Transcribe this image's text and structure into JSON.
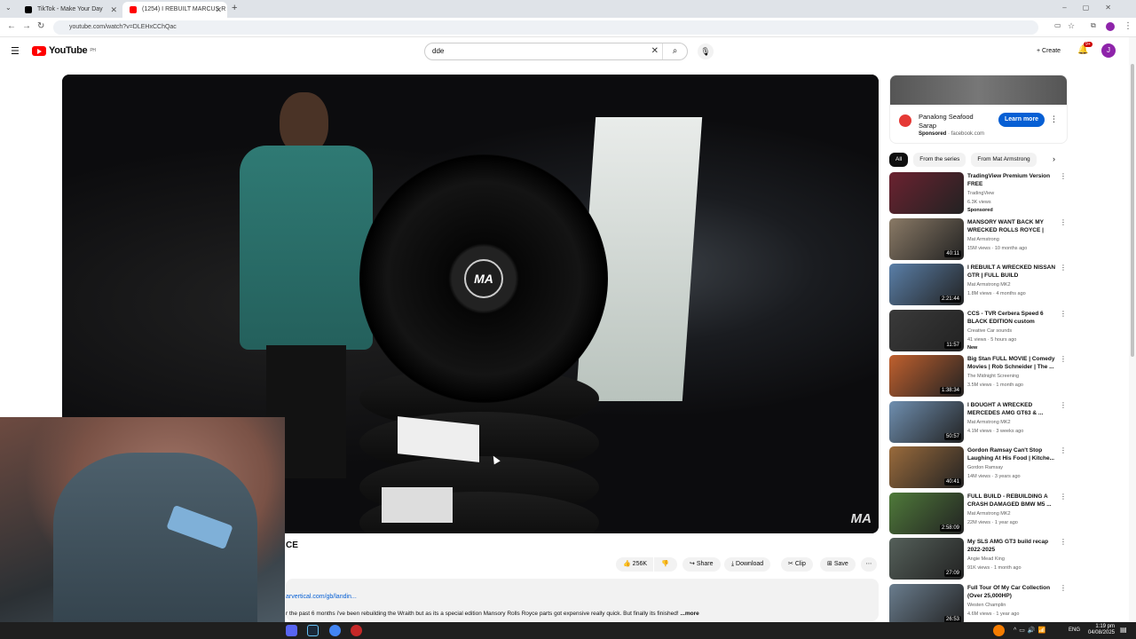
{
  "browser": {
    "tabs": [
      {
        "title": "TikTok - Make Your Day",
        "active": false
      },
      {
        "title": "(1254) I REBUILT MARCUS R",
        "active": true
      }
    ],
    "new_tab": "+",
    "url": "youtube.com/watch?v=DLEHxCChQac"
  },
  "youtube": {
    "logo_text": "YouTube",
    "logo_suffix": "PH",
    "search_value": "dde",
    "create_label": "Create",
    "notifications_badge": "9+",
    "avatar_initial": "J"
  },
  "video": {
    "watermark": "MA",
    "wheel_logo": "MA",
    "title_visible": "CE",
    "likes": "256K",
    "share_label": "Share",
    "download_label": "Download",
    "clip_label": "Clip",
    "save_label": "Save",
    "description_link": "arvertical.com/gb/landin...",
    "description_text": "r the past 6 months i've been rebuilding the Wraith but as its a special edition Mansory Rolls Royce parts got expensive really quick. But finally its finished!",
    "more_label": "...more"
  },
  "ad": {
    "name": "Panalong Seafood Sarap",
    "sponsored": "Sponsored",
    "domain": "facebook.com",
    "cta": "Learn more"
  },
  "chips": [
    "All",
    "From the series",
    "From Mat Armstrong"
  ],
  "recommendations": [
    {
      "title": "TradingView Premium Version FREE",
      "channel": "TradingView",
      "views": "6.3K views",
      "badge": "Sponsored",
      "duration": "",
      "color": "#6b2230"
    },
    {
      "title": "MANSORY WANT BACK MY WRECKED ROLLS ROYCE | JU...",
      "channel": "Mat Armstrong",
      "views": "15M views · 10 months ago",
      "badge": "",
      "duration": "40:11",
      "color": "#8a7a66"
    },
    {
      "title": "I REBUILT A WRECKED NISSAN GTR | FULL BUILD",
      "channel": "Mat Armstrong MK2",
      "views": "1.8M views · 4 months ago",
      "badge": "",
      "duration": "2:21:44",
      "color": "#5a7fa8"
    },
    {
      "title": "CCS - TVR Cerbera Speed 6 BLACK EDITION custom audio...",
      "channel": "Creative Car sounds",
      "views": "41 views · 5 hours ago",
      "badge": "New",
      "duration": "11:57",
      "color": "#3a3a3a"
    },
    {
      "title": "Big Stan FULL MOVIE | Comedy Movies | Rob Schneider | The ...",
      "channel": "The Midnight Screening",
      "views": "3.5M views · 1 month ago",
      "badge": "",
      "duration": "1:38:34",
      "color": "#c0602e"
    },
    {
      "title": "I BOUGHT A WRECKED MERCEDES AMG GT63 & ...",
      "channel": "Mat Armstrong MK2",
      "views": "4.1M views · 3 weeks ago",
      "badge": "",
      "duration": "50:57",
      "color": "#6f8fb0"
    },
    {
      "title": "Gordon Ramsay Can't Stop Laughing At His Food | Kitche...",
      "channel": "Gordon Ramsay",
      "views": "14M views · 3 years ago",
      "badge": "",
      "duration": "40:41",
      "color": "#9a6b3c"
    },
    {
      "title": "FULL BUILD - REBUILDING A CRASH DAMAGED BMW M5 ...",
      "channel": "Mat Armstrong MK2",
      "views": "22M views · 1 year ago",
      "badge": "",
      "duration": "2:58:09",
      "color": "#4f7a3a"
    },
    {
      "title": "My SLS AMG GT3 build recap 2022-2025",
      "channel": "Angie Mead King",
      "views": "91K views · 1 month ago",
      "badge": "",
      "duration": "27:09",
      "color": "#55605a"
    },
    {
      "title": "Full Tour Of My Car Collection (Over 25,000HP)",
      "channel": "Westen Champlin",
      "views": "4.6M views · 1 year ago",
      "badge": "",
      "duration": "26:53",
      "color": "#6a7d8e"
    }
  ],
  "taskbar": {
    "language": "ENG",
    "time": "1:19 pm",
    "date": "04/08/2025"
  }
}
